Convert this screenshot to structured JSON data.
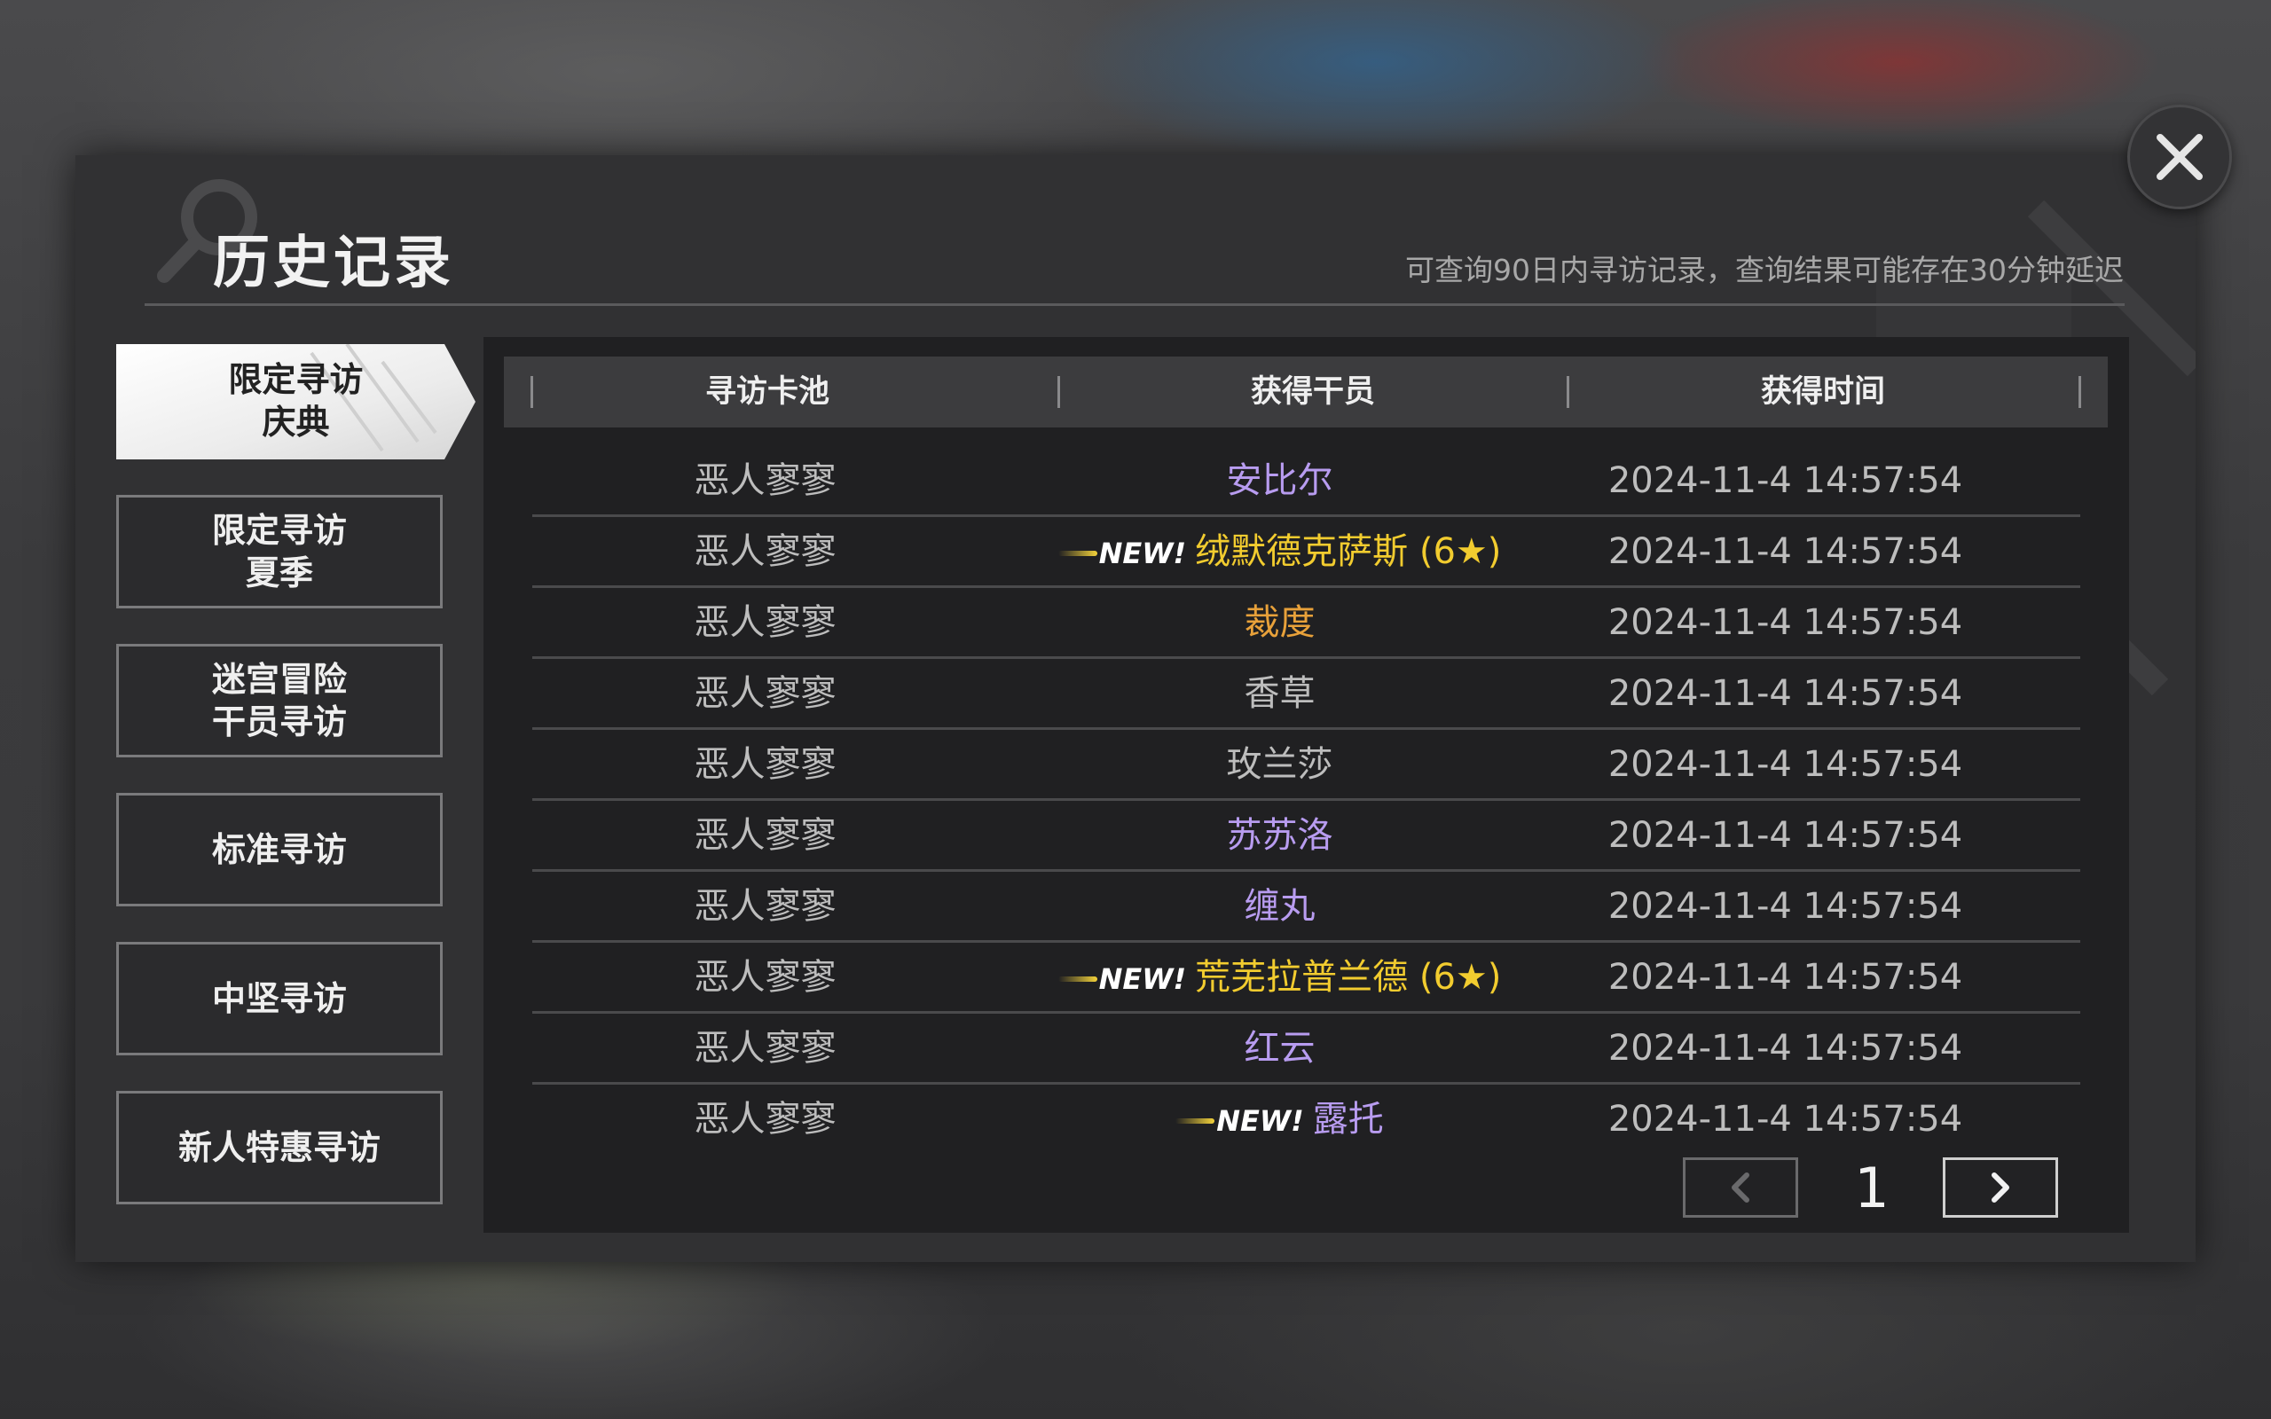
{
  "window": {
    "title": "历史记录",
    "notice": "可查询90日内寻访记录，查询结果可能存在30分钟延迟"
  },
  "icons": {
    "close": "close-icon",
    "search": "search-icon",
    "prev": "chevron-left-icon",
    "next": "chevron-right-icon"
  },
  "colors": {
    "six_star": "#f2cc2f",
    "five_star": "#e8a13a",
    "four_star": "#b89cf0",
    "three_star": "#bdbdbd"
  },
  "sidebar": {
    "items": [
      {
        "label": "限定寻访\n庆典",
        "active": true
      },
      {
        "label": "限定寻访\n夏季",
        "active": false
      },
      {
        "label": "迷宫冒险\n干员寻访",
        "active": false
      },
      {
        "label": "标准寻访",
        "active": false
      },
      {
        "label": "中坚寻访",
        "active": false
      },
      {
        "label": "新人特惠寻访",
        "active": false
      }
    ]
  },
  "table": {
    "headers": [
      "寻访卡池",
      "获得干员",
      "获得时间"
    ],
    "new_label": "NEW!",
    "rows": [
      {
        "pool": "恶人寥寥",
        "operator": "安比尔",
        "rarity": "four_star",
        "is_new": false,
        "time": "2024-11-4 14:57:54"
      },
      {
        "pool": "恶人寥寥",
        "operator": "绒默德克萨斯 (6★)",
        "rarity": "six_star",
        "is_new": true,
        "time": "2024-11-4 14:57:54"
      },
      {
        "pool": "恶人寥寥",
        "operator": "裁度",
        "rarity": "five_star",
        "is_new": false,
        "time": "2024-11-4 14:57:54"
      },
      {
        "pool": "恶人寥寥",
        "operator": "香草",
        "rarity": "three_star",
        "is_new": false,
        "time": "2024-11-4 14:57:54"
      },
      {
        "pool": "恶人寥寥",
        "operator": "玫兰莎",
        "rarity": "three_star",
        "is_new": false,
        "time": "2024-11-4 14:57:54"
      },
      {
        "pool": "恶人寥寥",
        "operator": "苏苏洛",
        "rarity": "four_star",
        "is_new": false,
        "time": "2024-11-4 14:57:54"
      },
      {
        "pool": "恶人寥寥",
        "operator": "缠丸",
        "rarity": "four_star",
        "is_new": false,
        "time": "2024-11-4 14:57:54"
      },
      {
        "pool": "恶人寥寥",
        "operator": "荒芜拉普兰德 (6★)",
        "rarity": "six_star",
        "is_new": true,
        "time": "2024-11-4 14:57:54"
      },
      {
        "pool": "恶人寥寥",
        "operator": "红云",
        "rarity": "four_star",
        "is_new": false,
        "time": "2024-11-4 14:57:54"
      },
      {
        "pool": "恶人寥寥",
        "operator": "露托",
        "rarity": "four_star",
        "is_new": true,
        "time": "2024-11-4 14:57:54"
      }
    ]
  },
  "pager": {
    "current_page": "1"
  }
}
